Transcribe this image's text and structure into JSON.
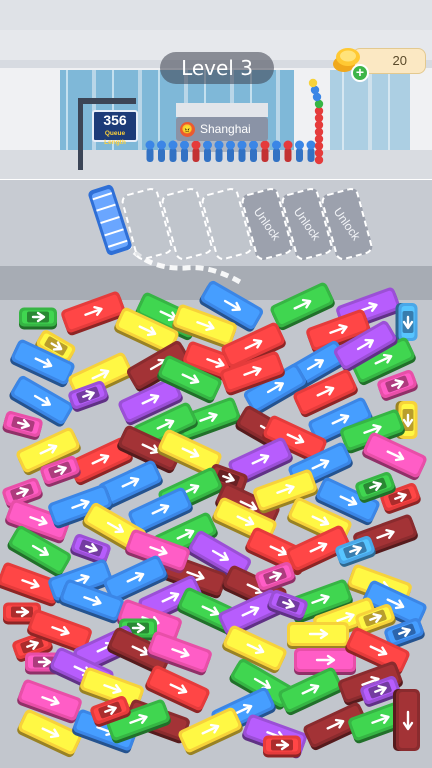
{
  "hud": {
    "level_label": "Level 3",
    "coins": "20"
  },
  "station": {
    "queue_number": "356",
    "queue_label": "Queue Length",
    "city": "Shanghai"
  },
  "parking": {
    "slots": [
      "",
      "",
      "",
      "Unlock",
      "Unlock",
      "Unlock"
    ]
  },
  "colors": {
    "red": "#e53b3b",
    "yellow": "#f7d23a",
    "green": "#36b544",
    "blue": "#3b86e6",
    "purple": "#9b4fd6",
    "pink": "#e84fa8",
    "maroon": "#8a2b2e",
    "sky": "#4aa7e8"
  },
  "board": {
    "vehicles": [
      [
        "bus",
        "red",
        93,
        312,
        -20
      ],
      [
        "bus",
        "green",
        168,
        315,
        25
      ],
      [
        "bus",
        "blue",
        232,
        305,
        30
      ],
      [
        "bus",
        "green",
        302,
        305,
        -25
      ],
      [
        "bus",
        "purple",
        368,
        308,
        -20
      ],
      [
        "car",
        "green",
        38,
        317,
        0
      ],
      [
        "car",
        "sky",
        408,
        322,
        90
      ],
      [
        "bus",
        "yellow",
        147,
        330,
        25
      ],
      [
        "bus",
        "yellow",
        205,
        325,
        20
      ],
      [
        "bus",
        "red",
        338,
        330,
        -20
      ],
      [
        "car",
        "yellow",
        56,
        346,
        30
      ],
      [
        "bus",
        "blue",
        43,
        362,
        25
      ],
      [
        "bus",
        "yellow",
        100,
        375,
        -25
      ],
      [
        "bus",
        "maroon",
        158,
        365,
        -30
      ],
      [
        "bus",
        "red",
        215,
        362,
        20
      ],
      [
        "bus",
        "red",
        253,
        345,
        -25
      ],
      [
        "bus",
        "green",
        383,
        360,
        -25
      ],
      [
        "bus",
        "blue",
        315,
        365,
        -30
      ],
      [
        "car",
        "pink",
        397,
        384,
        -20
      ],
      [
        "bus",
        "purple",
        365,
        345,
        -30
      ],
      [
        "bus",
        "blue",
        42,
        400,
        30
      ],
      [
        "bus",
        "purple",
        150,
        400,
        -25
      ],
      [
        "bus",
        "green",
        190,
        378,
        25
      ],
      [
        "bus",
        "blue",
        275,
        388,
        -30
      ],
      [
        "bus",
        "red",
        325,
        392,
        -25
      ],
      [
        "bus",
        "red",
        252,
        372,
        -20
      ],
      [
        "car",
        "purple",
        88,
        395,
        -20
      ],
      [
        "car",
        "pink",
        23,
        424,
        15
      ],
      [
        "car",
        "yellow",
        408,
        420,
        90
      ],
      [
        "bus",
        "green",
        208,
        418,
        -20
      ],
      [
        "bus",
        "green",
        165,
        425,
        -25
      ],
      [
        "bus",
        "maroon",
        268,
        430,
        30
      ],
      [
        "bus",
        "blue",
        340,
        420,
        -25
      ],
      [
        "bus",
        "green",
        372,
        430,
        -20
      ],
      [
        "bus",
        "yellow",
        48,
        450,
        -25
      ],
      [
        "bus",
        "red",
        100,
        460,
        -25
      ],
      [
        "bus",
        "maroon",
        150,
        448,
        25
      ],
      [
        "bus",
        "yellow",
        190,
        452,
        25
      ],
      [
        "bus",
        "red",
        295,
        438,
        25
      ],
      [
        "bus",
        "purple",
        260,
        460,
        -25
      ],
      [
        "bus",
        "pink",
        395,
        455,
        25
      ],
      [
        "bus",
        "blue",
        320,
        465,
        -25
      ],
      [
        "car",
        "pink",
        60,
        470,
        -20
      ],
      [
        "bus",
        "blue",
        130,
        483,
        -25
      ],
      [
        "car",
        "maroon",
        228,
        478,
        20
      ],
      [
        "car",
        "pink",
        22,
        492,
        -20
      ],
      [
        "bus",
        "pink",
        38,
        520,
        20
      ],
      [
        "bus",
        "blue",
        80,
        505,
        -20
      ],
      [
        "bus",
        "green",
        190,
        490,
        -25
      ],
      [
        "bus",
        "maroon",
        248,
        505,
        25
      ],
      [
        "bus",
        "yellow",
        285,
        490,
        -20
      ],
      [
        "bus",
        "blue",
        348,
        500,
        25
      ],
      [
        "car",
        "red",
        400,
        497,
        -20
      ],
      [
        "car",
        "green",
        375,
        486,
        -20
      ],
      [
        "bus",
        "blue",
        160,
        510,
        -25
      ],
      [
        "car",
        "purple",
        91,
        548,
        20
      ],
      [
        "bus",
        "yellow",
        115,
        527,
        30
      ],
      [
        "bus",
        "green",
        185,
        535,
        -25
      ],
      [
        "bus",
        "yellow",
        245,
        520,
        25
      ],
      [
        "bus",
        "purple",
        220,
        555,
        30
      ],
      [
        "bus",
        "maroon",
        195,
        575,
        20
      ],
      [
        "bus",
        "yellow",
        320,
        520,
        25
      ],
      [
        "bus",
        "maroon",
        385,
        535,
        -20
      ],
      [
        "bus",
        "green",
        40,
        550,
        30
      ],
      [
        "bus",
        "pink",
        158,
        550,
        20
      ],
      [
        "bus",
        "red",
        278,
        550,
        25
      ],
      [
        "bus",
        "red",
        318,
        548,
        -25
      ],
      [
        "car",
        "sky",
        355,
        550,
        -20
      ],
      [
        "bus",
        "red",
        30,
        583,
        20
      ],
      [
        "bus",
        "blue",
        80,
        580,
        -20
      ],
      [
        "bus",
        "blue",
        135,
        578,
        -25
      ],
      [
        "bus",
        "purple",
        170,
        598,
        -25
      ],
      [
        "bus",
        "maroon",
        255,
        588,
        25
      ],
      [
        "bus",
        "yellow",
        380,
        585,
        20
      ],
      [
        "bus",
        "blue",
        395,
        603,
        25
      ],
      [
        "car",
        "pink",
        275,
        576,
        -20
      ],
      [
        "car",
        "red",
        22,
        612,
        0
      ],
      [
        "bus",
        "blue",
        92,
        600,
        20
      ],
      [
        "bus",
        "pink",
        150,
        620,
        20
      ],
      [
        "bus",
        "green",
        210,
        610,
        25
      ],
      [
        "bus",
        "purple",
        250,
        612,
        -25
      ],
      [
        "bus",
        "green",
        320,
        600,
        -20
      ],
      [
        "bus",
        "yellow",
        345,
        618,
        -20
      ],
      [
        "car",
        "purple",
        288,
        604,
        20
      ],
      [
        "car",
        "yellow",
        375,
        618,
        -20
      ],
      [
        "car",
        "blue",
        404,
        632,
        -20
      ],
      [
        "car",
        "red",
        32,
        645,
        -20
      ],
      [
        "car",
        "green",
        138,
        628,
        0
      ],
      [
        "bus",
        "red",
        60,
        630,
        20
      ],
      [
        "bus",
        "purple",
        105,
        648,
        -25
      ],
      [
        "bus",
        "maroon",
        140,
        650,
        25
      ],
      [
        "bus",
        "pink",
        180,
        652,
        20
      ],
      [
        "bus",
        "yellow",
        255,
        648,
        25
      ],
      [
        "bus",
        "yellow",
        318,
        634,
        0
      ],
      [
        "bus",
        "pink",
        325,
        660,
        0
      ],
      [
        "bus",
        "red",
        378,
        650,
        25
      ],
      [
        "car",
        "pink",
        44,
        662,
        0
      ],
      [
        "bus",
        "purple",
        82,
        670,
        25
      ],
      [
        "bus",
        "yellow",
        112,
        688,
        20
      ],
      [
        "bus",
        "green",
        262,
        683,
        30
      ],
      [
        "bus",
        "green",
        310,
        690,
        -25
      ],
      [
        "bus",
        "maroon",
        370,
        682,
        -20
      ],
      [
        "car",
        "purple",
        380,
        690,
        -20
      ],
      [
        "bus",
        "pink",
        50,
        700,
        20
      ],
      [
        "bus",
        "red",
        178,
        688,
        25
      ],
      [
        "bus",
        "blue",
        243,
        710,
        -25
      ],
      [
        "bus",
        "maroon",
        158,
        720,
        20
      ],
      [
        "bus",
        "yellow",
        210,
        730,
        -25
      ],
      [
        "bus",
        "purple",
        275,
        735,
        20
      ],
      [
        "bus",
        "maroon",
        335,
        725,
        -25
      ],
      [
        "bus",
        "green",
        380,
        720,
        -20
      ],
      [
        "bus",
        "maroon",
        408,
        720,
        90
      ],
      [
        "bus",
        "yellow",
        50,
        732,
        25
      ],
      [
        "bus",
        "blue",
        105,
        730,
        20
      ],
      [
        "car",
        "red",
        282,
        745,
        0
      ],
      [
        "bus",
        "green",
        138,
        720,
        -20
      ],
      [
        "car",
        "red",
        110,
        710,
        -20
      ]
    ],
    "queue_people": [
      "blue",
      "blue",
      "blue",
      "blue",
      "red",
      "blue",
      "blue",
      "blue",
      "blue",
      "blue",
      "red",
      "blue",
      "red",
      "blue",
      "blue"
    ],
    "column_people": [
      "red",
      "red",
      "red",
      "red",
      "red",
      "red",
      "red",
      "red",
      "green",
      "blue",
      "blue",
      "yellow"
    ]
  }
}
